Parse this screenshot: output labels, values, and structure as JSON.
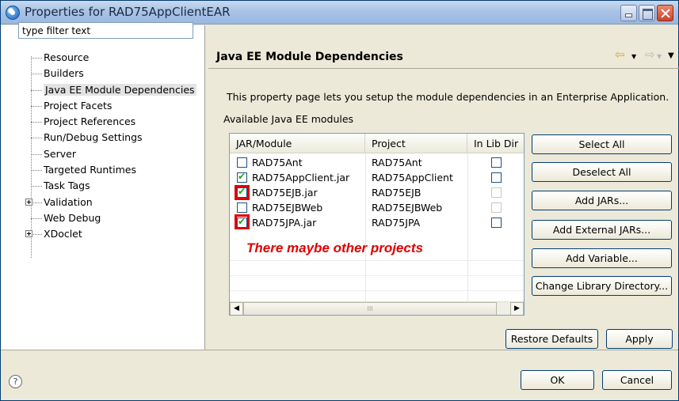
{
  "window": {
    "title": "Properties for RAD75AppClientEAR"
  },
  "filter": {
    "value": "type filter text"
  },
  "tree": {
    "items": [
      {
        "label": "Resource"
      },
      {
        "label": "Builders"
      },
      {
        "label": "Java EE Module Dependencies",
        "selected": true
      },
      {
        "label": "Project Facets"
      },
      {
        "label": "Project References"
      },
      {
        "label": "Run/Debug Settings"
      },
      {
        "label": "Server"
      },
      {
        "label": "Targeted Runtimes"
      },
      {
        "label": "Task Tags"
      },
      {
        "label": "Validation",
        "expandable": true
      },
      {
        "label": "Web Debug"
      },
      {
        "label": "XDoclet",
        "expandable": true
      }
    ]
  },
  "page": {
    "title": "Java EE Module Dependencies",
    "description": "This property page lets you setup the module dependencies in an Enterprise Application.",
    "available_label": "Available Java EE modules",
    "note": "There maybe other projects"
  },
  "table": {
    "columns": [
      "JAR/Module",
      "Project",
      "In Lib Dir"
    ],
    "rows": [
      {
        "module": "RAD75Ant",
        "project": "RAD75Ant",
        "checked": false
      },
      {
        "module": "RAD75AppClient.jar",
        "project": "RAD75AppClient",
        "checked": true
      },
      {
        "module": "RAD75EJB.jar",
        "project": "RAD75EJB",
        "checked": true
      },
      {
        "module": "RAD75EJBWeb",
        "project": "RAD75EJBWeb",
        "checked": false
      },
      {
        "module": "RAD75JPA.jar",
        "project": "RAD75JPA",
        "checked": true
      }
    ]
  },
  "buttons": {
    "select_all": "Select All",
    "deselect_all": "Deselect All",
    "add_jars": "Add JARs...",
    "add_external_jars": "Add External JARs...",
    "add_variable": "Add Variable...",
    "change_library_directory": "Change Library Directory...",
    "restore_defaults": "Restore Defaults",
    "apply": "Apply",
    "ok": "OK",
    "cancel": "Cancel"
  },
  "colors": {
    "highlight_red": "#e00000",
    "check_green": "#21a121"
  }
}
